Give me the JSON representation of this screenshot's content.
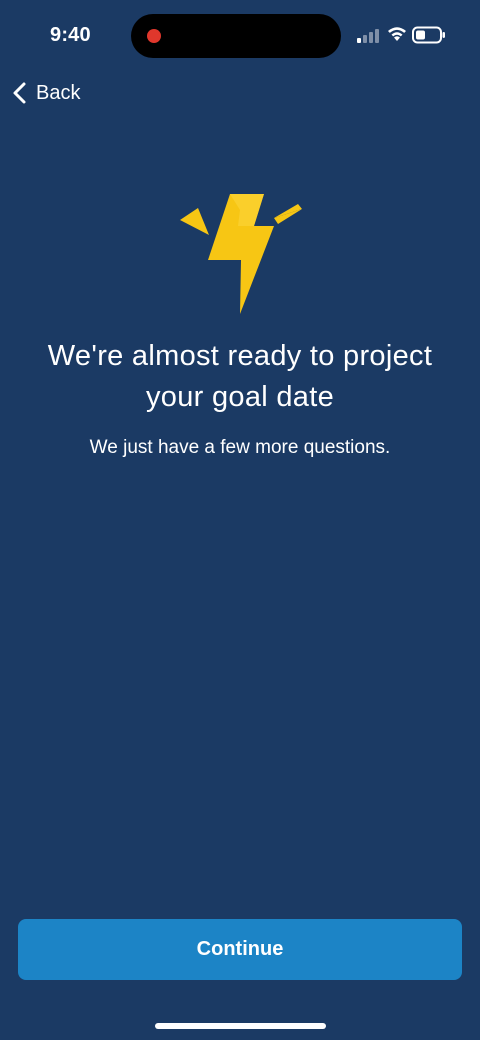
{
  "status_bar": {
    "time": "9:40",
    "icons": [
      "signal-icon",
      "wifi-icon",
      "battery-icon"
    ],
    "recording_indicator_color": "#e0372c"
  },
  "nav": {
    "back_label": "Back"
  },
  "hero": {
    "icon": "lightning-bolt-icon",
    "icon_color": "#f7c614",
    "headline": "We're almost ready to project your goal date",
    "subtext": "We just have a few more questions."
  },
  "footer": {
    "continue_label": "Continue"
  },
  "colors": {
    "background": "#1b3a64",
    "primary_button": "#1c84c6",
    "text": "#ffffff"
  }
}
